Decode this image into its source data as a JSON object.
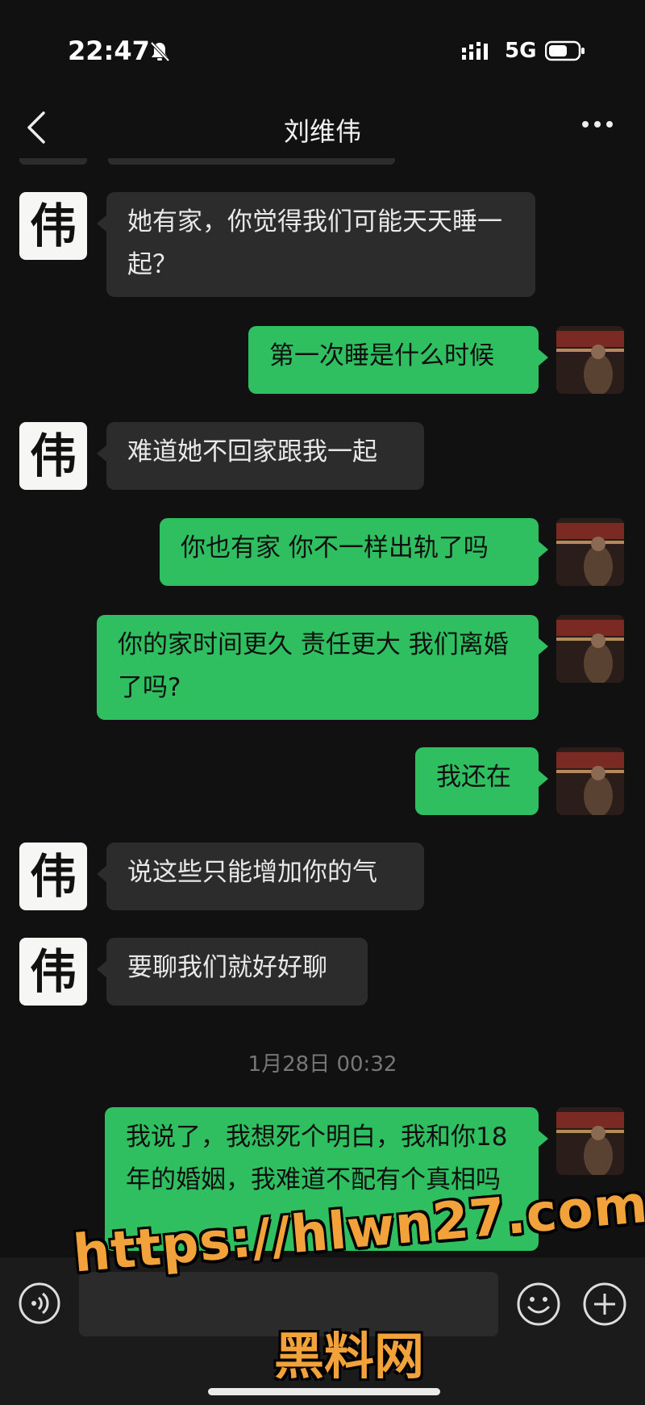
{
  "status_bar": {
    "time": "22:47",
    "network": "5G"
  },
  "header": {
    "title": "刘维伟"
  },
  "contact_avatar_glyph": "伟",
  "messages": [
    {
      "side": "in",
      "text": "她有家，你觉得我们可能天天睡一起？"
    },
    {
      "side": "out",
      "text": "第一次睡是什么时候"
    },
    {
      "side": "in",
      "text": "难道她不回家跟我一起"
    },
    {
      "side": "out",
      "text": "你也有家 你不一样出轨了吗"
    },
    {
      "side": "out",
      "text": "你的家时间更久 责任更大 我们离婚了吗?"
    },
    {
      "side": "out",
      "text": "我还在"
    },
    {
      "side": "in",
      "text": "说这些只能增加你的气"
    },
    {
      "side": "in",
      "text": "要聊我们就好好聊"
    },
    {
      "side": "out",
      "text": "我说了，我想死个明白，我和你18年的婚姻，我难道不配有个真相吗"
    }
  ],
  "timestamp": "1月28日 00:32",
  "watermark": {
    "url": "https://hlwn27.com",
    "name": "黑料网"
  },
  "colors": {
    "incoming_bubble": "#2c2c2c",
    "outgoing_bubble": "#2fbf60",
    "background": "#111111",
    "watermark": "#f2a23a"
  },
  "icons": [
    "bell-off-icon",
    "signal-icon",
    "battery-icon",
    "back-icon",
    "more-icon",
    "voice-icon",
    "emoji-icon",
    "plus-icon"
  ]
}
